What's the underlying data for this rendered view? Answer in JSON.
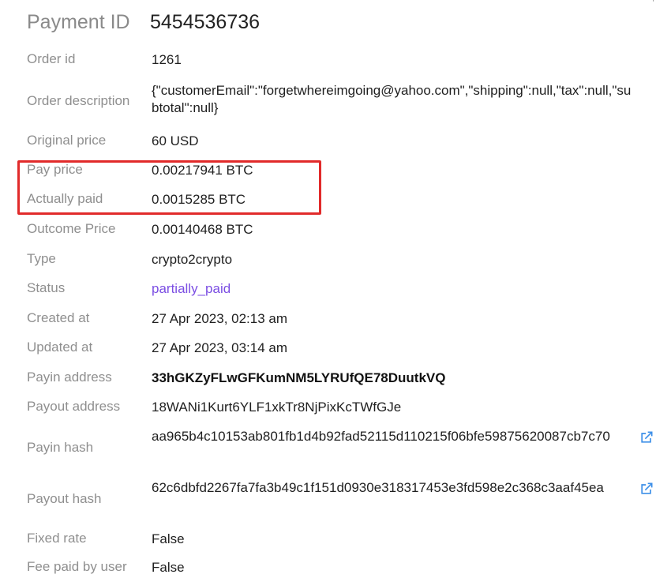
{
  "header": {
    "label": "Payment ID",
    "value": "5454536736"
  },
  "fields": {
    "order_id": {
      "label": "Order id",
      "value": "1261"
    },
    "order_description": {
      "label": "Order description",
      "value": "{\"customerEmail\":\"forgetwhereimgoing@yahoo.com\",\"shipping\":null,\"tax\":null,\"subtotal\":null}"
    },
    "original_price": {
      "label": "Original price",
      "value": "60 USD"
    },
    "pay_price": {
      "label": "Pay price",
      "value": "0.00217941 BTC"
    },
    "actually_paid": {
      "label": "Actually paid",
      "value": "0.0015285 BTC"
    },
    "outcome_price": {
      "label": "Outcome Price",
      "value": "0.00140468 BTC"
    },
    "type": {
      "label": "Type",
      "value": "crypto2crypto"
    },
    "status": {
      "label": "Status",
      "value": "partially_paid"
    },
    "created_at": {
      "label": "Created at",
      "value": "27 Apr 2023, 02:13 am"
    },
    "updated_at": {
      "label": "Updated at",
      "value": "27 Apr 2023, 03:14 am"
    },
    "payin_address": {
      "label": "Payin address",
      "value": "33hGKZyFLwGFKumNM5LYRUfQE78DuutkVQ"
    },
    "payout_address": {
      "label": "Payout address",
      "value": "18WANi1Kurt6YLF1xkTr8NjPixKcTWfGJe"
    },
    "payin_hash": {
      "label": "Payin hash",
      "value": "aa965b4c10153ab801fb1d4b92fad52115d110215f06bfe59875620087cb7c70"
    },
    "payout_hash": {
      "label": "Payout hash",
      "value": "62c6dbfd2267fa7fa3b49c1f151d0930e318317453e3fd598e2c368c3aaf45ea"
    },
    "fixed_rate": {
      "label": "Fixed rate",
      "value": "False"
    },
    "fee_paid_by_user": {
      "label": "Fee paid by user",
      "value": "False"
    }
  },
  "icons": {
    "external_link": "external-link-icon"
  },
  "colors": {
    "label": "#8f8f8f",
    "value": "#1f1f1f",
    "status": "#7b4ee3",
    "link_icon": "#3d8fe8",
    "highlight_box": "#e12a2a"
  }
}
